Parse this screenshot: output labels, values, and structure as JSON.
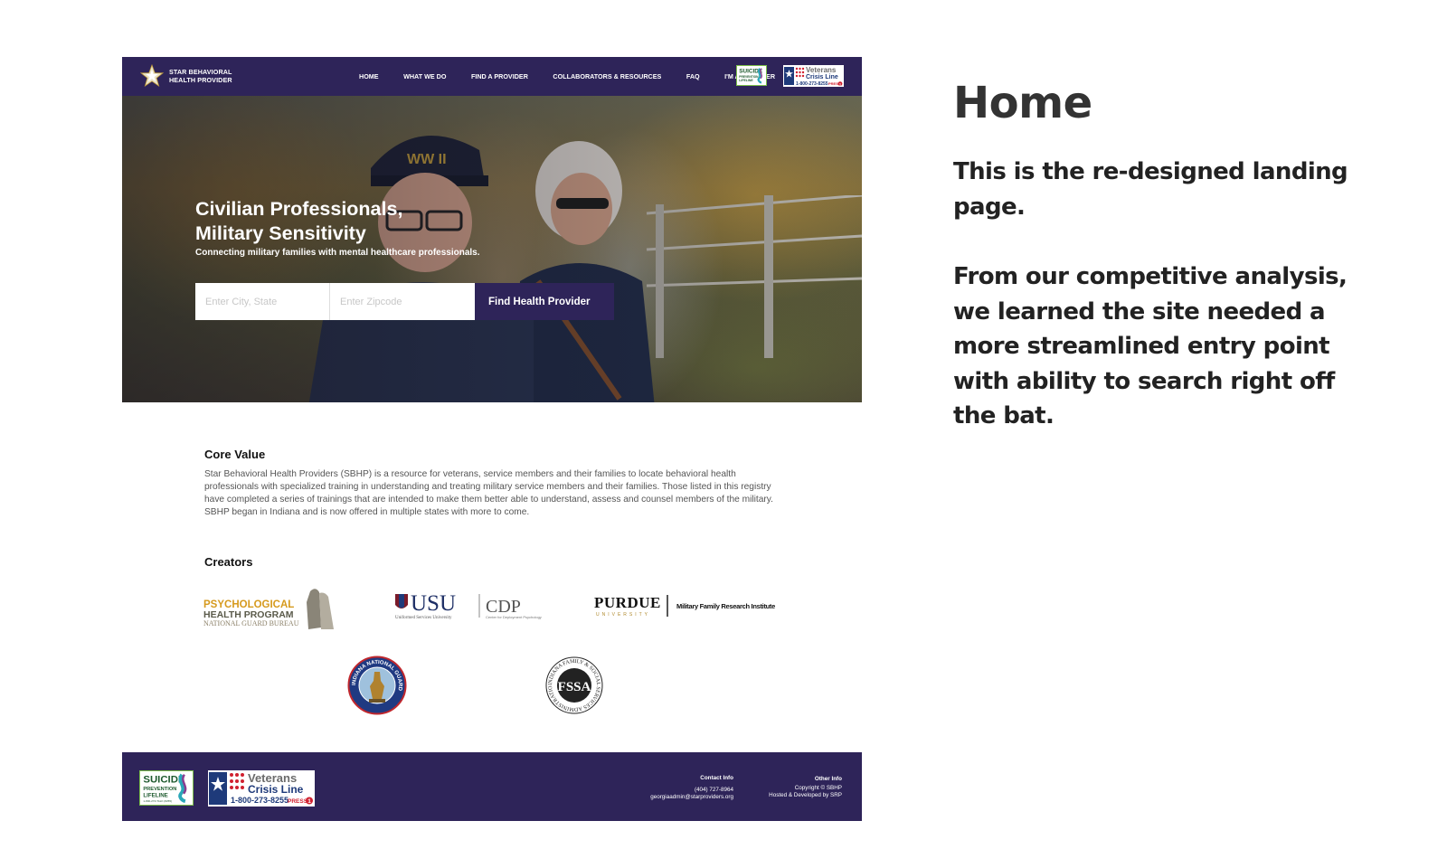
{
  "header": {
    "brand_line1": "STAR BEHAVIORAL",
    "brand_line2": "HEALTH PROVIDER",
    "nav": [
      "HOME",
      "WHAT WE DO",
      "FIND A PROVIDER",
      "COLLABORATORS & RESOURCES",
      "FAQ",
      "I'M A PROVIDER"
    ]
  },
  "hero": {
    "title_line1": "Civilian Professionals,",
    "title_line2": "Military Sensitivity",
    "subtitle": "Connecting military families with mental healthcare professionals.",
    "city_placeholder": "Enter City, State",
    "zip_placeholder": "Enter Zipcode",
    "search_button": "Find Health Provider"
  },
  "core_value": {
    "heading": "Core Value",
    "body": "Star Behavioral Health Providers (SBHP) is a resource for veterans, service members and their families to locate behavioral health professionals with specialized training in understanding and treating military service members and their families. Those listed in this registry have completed a series of trainings that are intended to make them better able to understand, assess and counsel members of the military. SBHP began in Indiana and is now offered in multiple states with more to come."
  },
  "creators": {
    "heading": "Creators",
    "psych_line1": "PSYCHOLOGICAL",
    "psych_line2": "HEALTH PROGRAM",
    "psych_line3": "NATIONAL GUARD BUREAU",
    "usu": "USU",
    "usu_sub": "Uniformed Services University",
    "cdp": "CDP",
    "cdp_sub": "Center for Deployment Psychology",
    "purdue": "PURDUE",
    "purdue_sub": "UNIVERSITY",
    "mfri": "Military Family Research Institute",
    "ing_ring": "INDIANA NATIONAL GUARD",
    "fssa_letters": "FSSA",
    "fssa_ring": "INDIANA FAMILY & SOCIAL SERVICES ADMINISTRATION"
  },
  "badges": {
    "suicide_line1": "SUICIDE",
    "suicide_line2": "PREVENTION",
    "suicide_line3": "LIFELINE",
    "suicide_phone": "1-800-273-TALK (8255)",
    "veterans_line1": "Veterans",
    "veterans_line2": "Crisis Line",
    "veterans_phone": "1-800-273-8255",
    "veterans_press": "PRESS",
    "veterans_press_num": "1"
  },
  "footer": {
    "contact_title": "Contact Info",
    "phone": "(404) 727-8964",
    "email": "georgiaadmin@starproviders.org",
    "other_title": "Other Info",
    "copyright": "Copyright © SBHP",
    "hosted": "Hosted & Developed by SRP"
  },
  "side": {
    "title": "Home",
    "para1": "This is the re-designed landing page.",
    "para2": "From our competitive analysis, we learned the site needed a more streamlined entry point with ability to search right off the bat."
  },
  "colors": {
    "brand_purple": "#2e2459",
    "gold": "#c8a23c",
    "lifeline_green": "#7cbf4a",
    "crisis_red": "#d0202f"
  }
}
